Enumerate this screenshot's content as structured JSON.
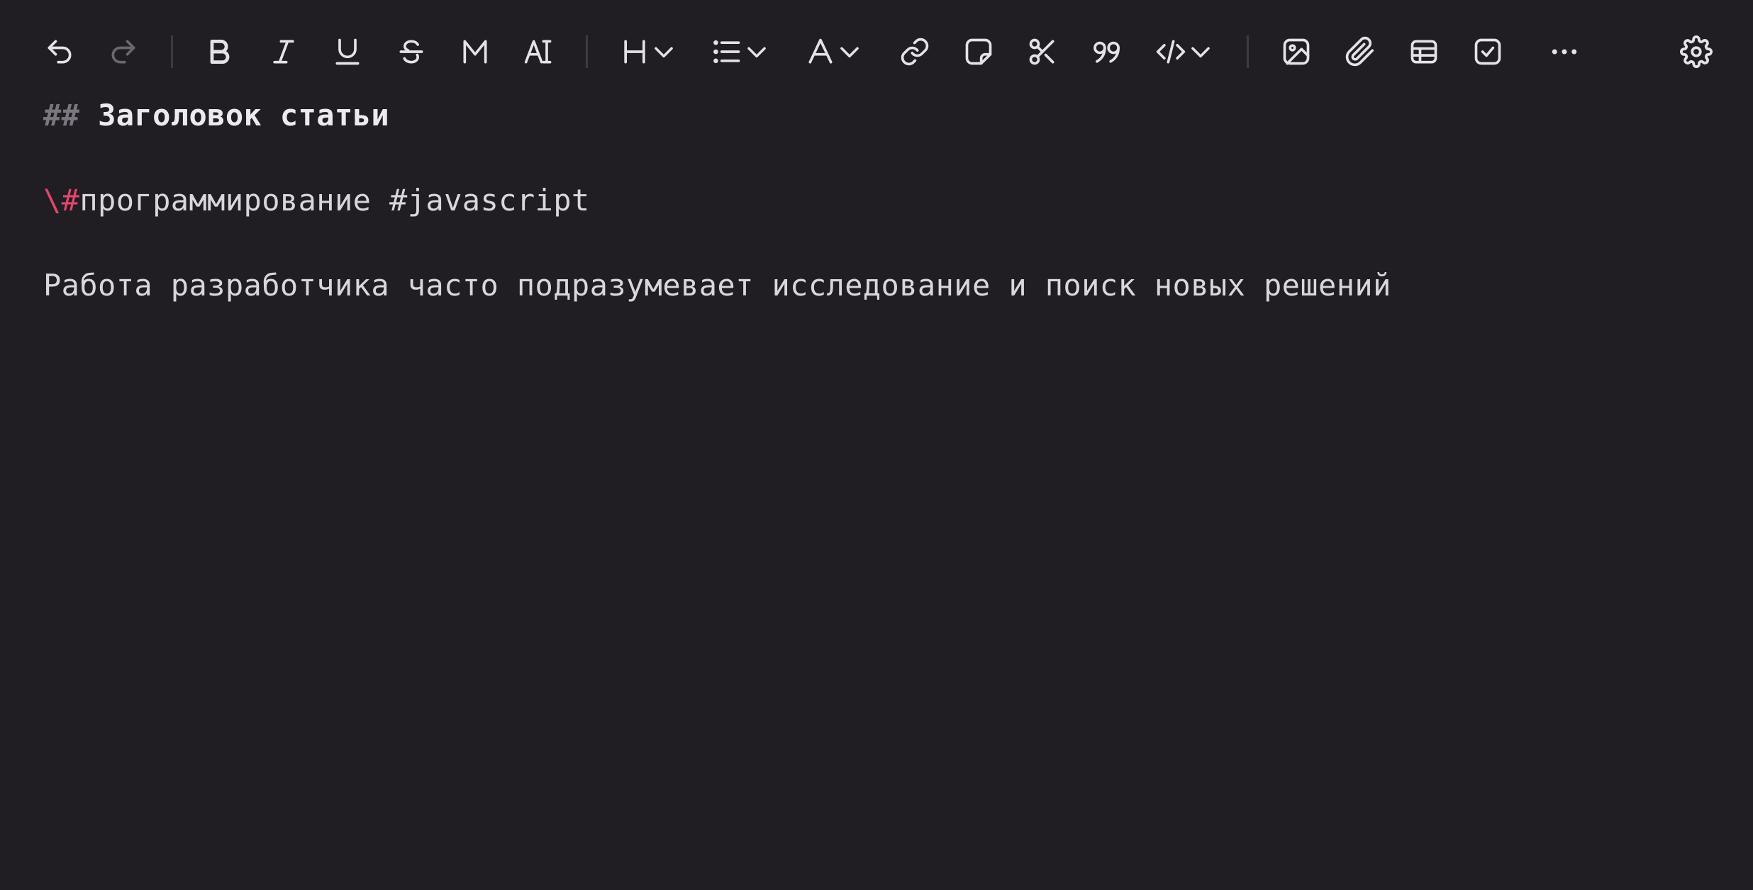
{
  "toolbar": {
    "buttons": [
      {
        "name": "undo-button",
        "icon": "undo-icon"
      },
      {
        "name": "redo-button",
        "icon": "redo-icon",
        "disabled": true
      },
      {
        "name": "bold-button",
        "icon": "bold-icon"
      },
      {
        "name": "italic-button",
        "icon": "italic-icon"
      },
      {
        "name": "underline-button",
        "icon": "underline-icon"
      },
      {
        "name": "strikethrough-button",
        "icon": "strikethrough-icon"
      },
      {
        "name": "mark-button",
        "icon": "mark-icon"
      },
      {
        "name": "clear-format-button",
        "icon": "clear-format-icon"
      },
      {
        "name": "heading-dropdown",
        "icon": "heading-icon"
      },
      {
        "name": "list-dropdown",
        "icon": "list-icon"
      },
      {
        "name": "text-color-dropdown",
        "icon": "text-color-icon"
      },
      {
        "name": "link-button",
        "icon": "link-icon"
      },
      {
        "name": "note-button",
        "icon": "sticky-note-icon"
      },
      {
        "name": "cut-button",
        "icon": "scissors-icon"
      },
      {
        "name": "quote-button",
        "icon": "quote-icon"
      },
      {
        "name": "code-dropdown",
        "icon": "code-icon"
      },
      {
        "name": "image-button",
        "icon": "image-icon"
      },
      {
        "name": "attachment-button",
        "icon": "paperclip-icon"
      },
      {
        "name": "table-button",
        "icon": "table-icon"
      },
      {
        "name": "checkbox-button",
        "icon": "checkbox-icon"
      },
      {
        "name": "more-button",
        "icon": "more-icon"
      },
      {
        "name": "settings-button",
        "icon": "gear-icon"
      }
    ],
    "heading_glyph": "H",
    "text_color_glyph": "A",
    "colors": {
      "icon": "#e4e2e7",
      "icon_disabled": "#6b676f",
      "separator": "#3e3a42"
    }
  },
  "document": {
    "heading_marker": "##",
    "heading_text": "Заголовок статьи",
    "tags_escape": "\\#",
    "tags_text": "программирование #javascript",
    "paragraph": "Работа разработчика часто подразумевает исследование и поиск новых решений"
  },
  "colors": {
    "background": "#211e23",
    "text": "#d9d7dc",
    "markdown_marker": "#7b7780",
    "escape_accent": "#e0476b"
  }
}
